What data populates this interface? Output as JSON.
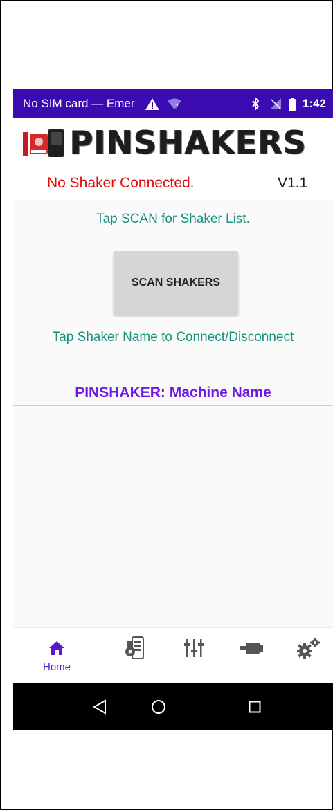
{
  "status_bar": {
    "carrier": "No SIM card — Emer",
    "time": "1:42",
    "icons": [
      "warning-icon",
      "wifi-question-icon",
      "bluetooth-icon",
      "no-signal-icon",
      "battery-icon"
    ],
    "background": "#3a0bb3"
  },
  "header": {
    "logo_text": "PINSHAKERS"
  },
  "connection": {
    "status": "No Shaker Connected.",
    "version": "V1.1"
  },
  "scan": {
    "hint": "Tap SCAN for Shaker List.",
    "button_label": "SCAN SHAKERS"
  },
  "device_list": {
    "hint": "Tap Shaker Name to Connect/Disconnect",
    "machine_name": "PINSHAKER: Machine Name"
  },
  "bottom_nav": {
    "items": [
      {
        "icon": "home-icon",
        "label": "Home",
        "selected": true
      },
      {
        "icon": "device-config-icon",
        "label": "",
        "selected": false
      },
      {
        "icon": "sliders-icon",
        "label": "",
        "selected": false
      },
      {
        "icon": "motor-icon",
        "label": "",
        "selected": false
      },
      {
        "icon": "gears-icon",
        "label": "",
        "selected": false
      }
    ],
    "active_color": "#5a16d6"
  },
  "system_nav": {
    "buttons": [
      "back-icon",
      "home-circle-icon",
      "recents-icon"
    ]
  },
  "colors": {
    "accent_teal": "#15917c",
    "error_red": "#e01010",
    "machine_purple": "#6d18e6"
  }
}
